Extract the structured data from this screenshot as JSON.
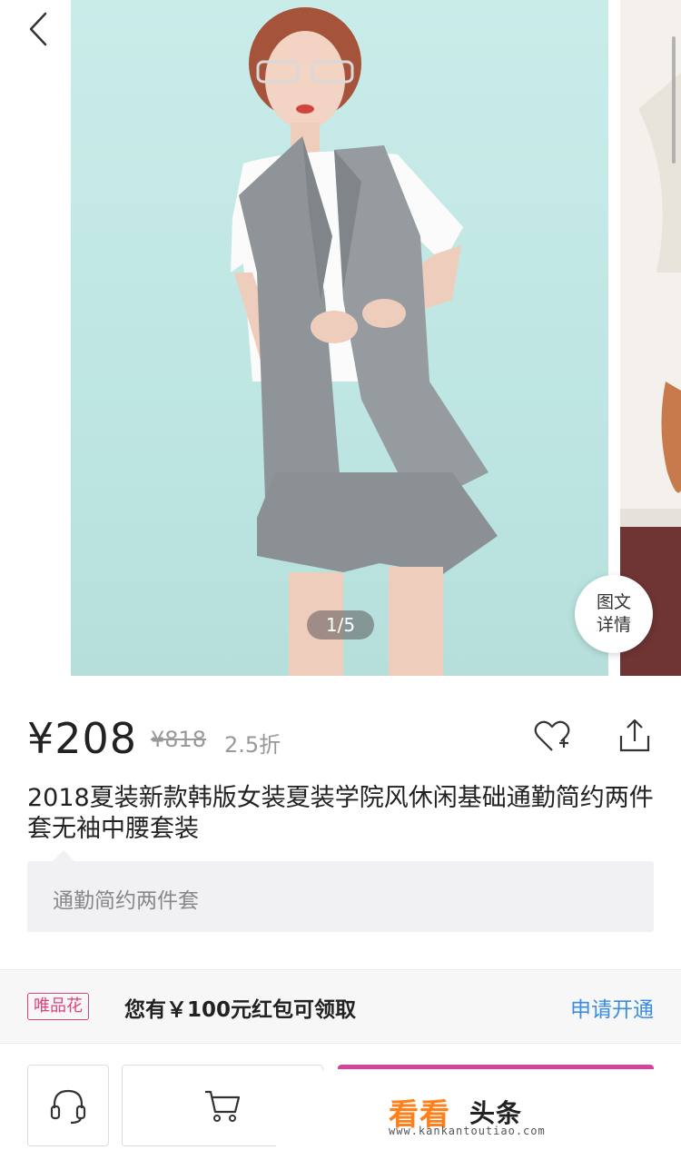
{
  "gallery": {
    "page_counter": "1/5",
    "detail_line1": "图文",
    "detail_line2": "详情"
  },
  "product": {
    "price": "¥208",
    "original_price": "¥818",
    "discount": "2.5折",
    "title": "2018夏装新款韩版女装夏装学院风休闲基础通勤简约两件套无袖中腰套装",
    "tag": "通勤简约两件套"
  },
  "promo": {
    "badge": "唯品花",
    "text": "您有￥100元红包可领取",
    "link": "申请开通"
  },
  "watermark": {
    "logo_orange": "看看",
    "logo_dark": "头条",
    "url": "www.kankantoutiao.com"
  },
  "icons": {
    "back": "chevron-left-icon",
    "favorite": "heart-plus-icon",
    "share": "share-icon",
    "service": "headset-icon",
    "cart": "cart-icon"
  },
  "colors": {
    "accent_pink": "#d4449b",
    "link_blue": "#3a8de0",
    "watermark_orange": "#ff7f1a"
  }
}
